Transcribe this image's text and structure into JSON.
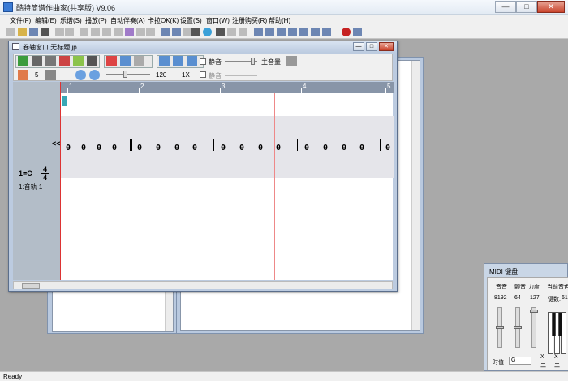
{
  "window": {
    "title": "酷特简谱作曲家(共享版) V9.06",
    "minimize_glyph": "—",
    "maximize_glyph": "□",
    "close_glyph": "✕"
  },
  "menu": [
    "文件(F)",
    "编辑(E)",
    "乐谱(S)",
    "播放(P)",
    "自动伴奏(A)",
    "卡拉OK(K)",
    "设置(S)",
    "窗口(W)",
    "注册购买(R)",
    "帮助(H)"
  ],
  "score_window": {
    "title": "卷轴窗口  无标题.jp",
    "tempo_value": "120",
    "speed_label": "1X",
    "number_label": "5",
    "mute_label_1": "静音",
    "main_volume_label": "主音量",
    "mute_label_2": "静音",
    "collapse_label": "<<",
    "key_label": "1=C",
    "time_sig_top": "4",
    "time_sig_bottom": "4",
    "track_label": "1:音轨 1",
    "ruler_marks": [
      "1",
      "2",
      "3",
      "4",
      "5"
    ],
    "notes": [
      "0",
      "0",
      "0",
      "0",
      "0",
      "0",
      "0",
      "0",
      "0",
      "0",
      "0",
      "0",
      "0",
      "0",
      "0",
      "0",
      "0"
    ]
  },
  "midi_panel": {
    "title": "MIDI 键盘",
    "labels": {
      "pitch": "音音",
      "tone": "颤音",
      "velocity": "力度",
      "current": "当前音色"
    },
    "values": {
      "pitch": "8192",
      "tone": "64",
      "velocity": "127",
      "keyname_label": "键数:",
      "keyname_value": "61"
    },
    "duration_label": "时值",
    "duration_value": "G",
    "x_buttons": [
      "X",
      "X"
    ],
    "bottom_labels": [
      "二",
      "二"
    ]
  },
  "status": {
    "text": "Ready"
  },
  "colors": {
    "title_bg": "#e3ebf4",
    "score_bg": "#bccbe0",
    "cursor": "#39a7b5",
    "playhead": "#e88888"
  }
}
